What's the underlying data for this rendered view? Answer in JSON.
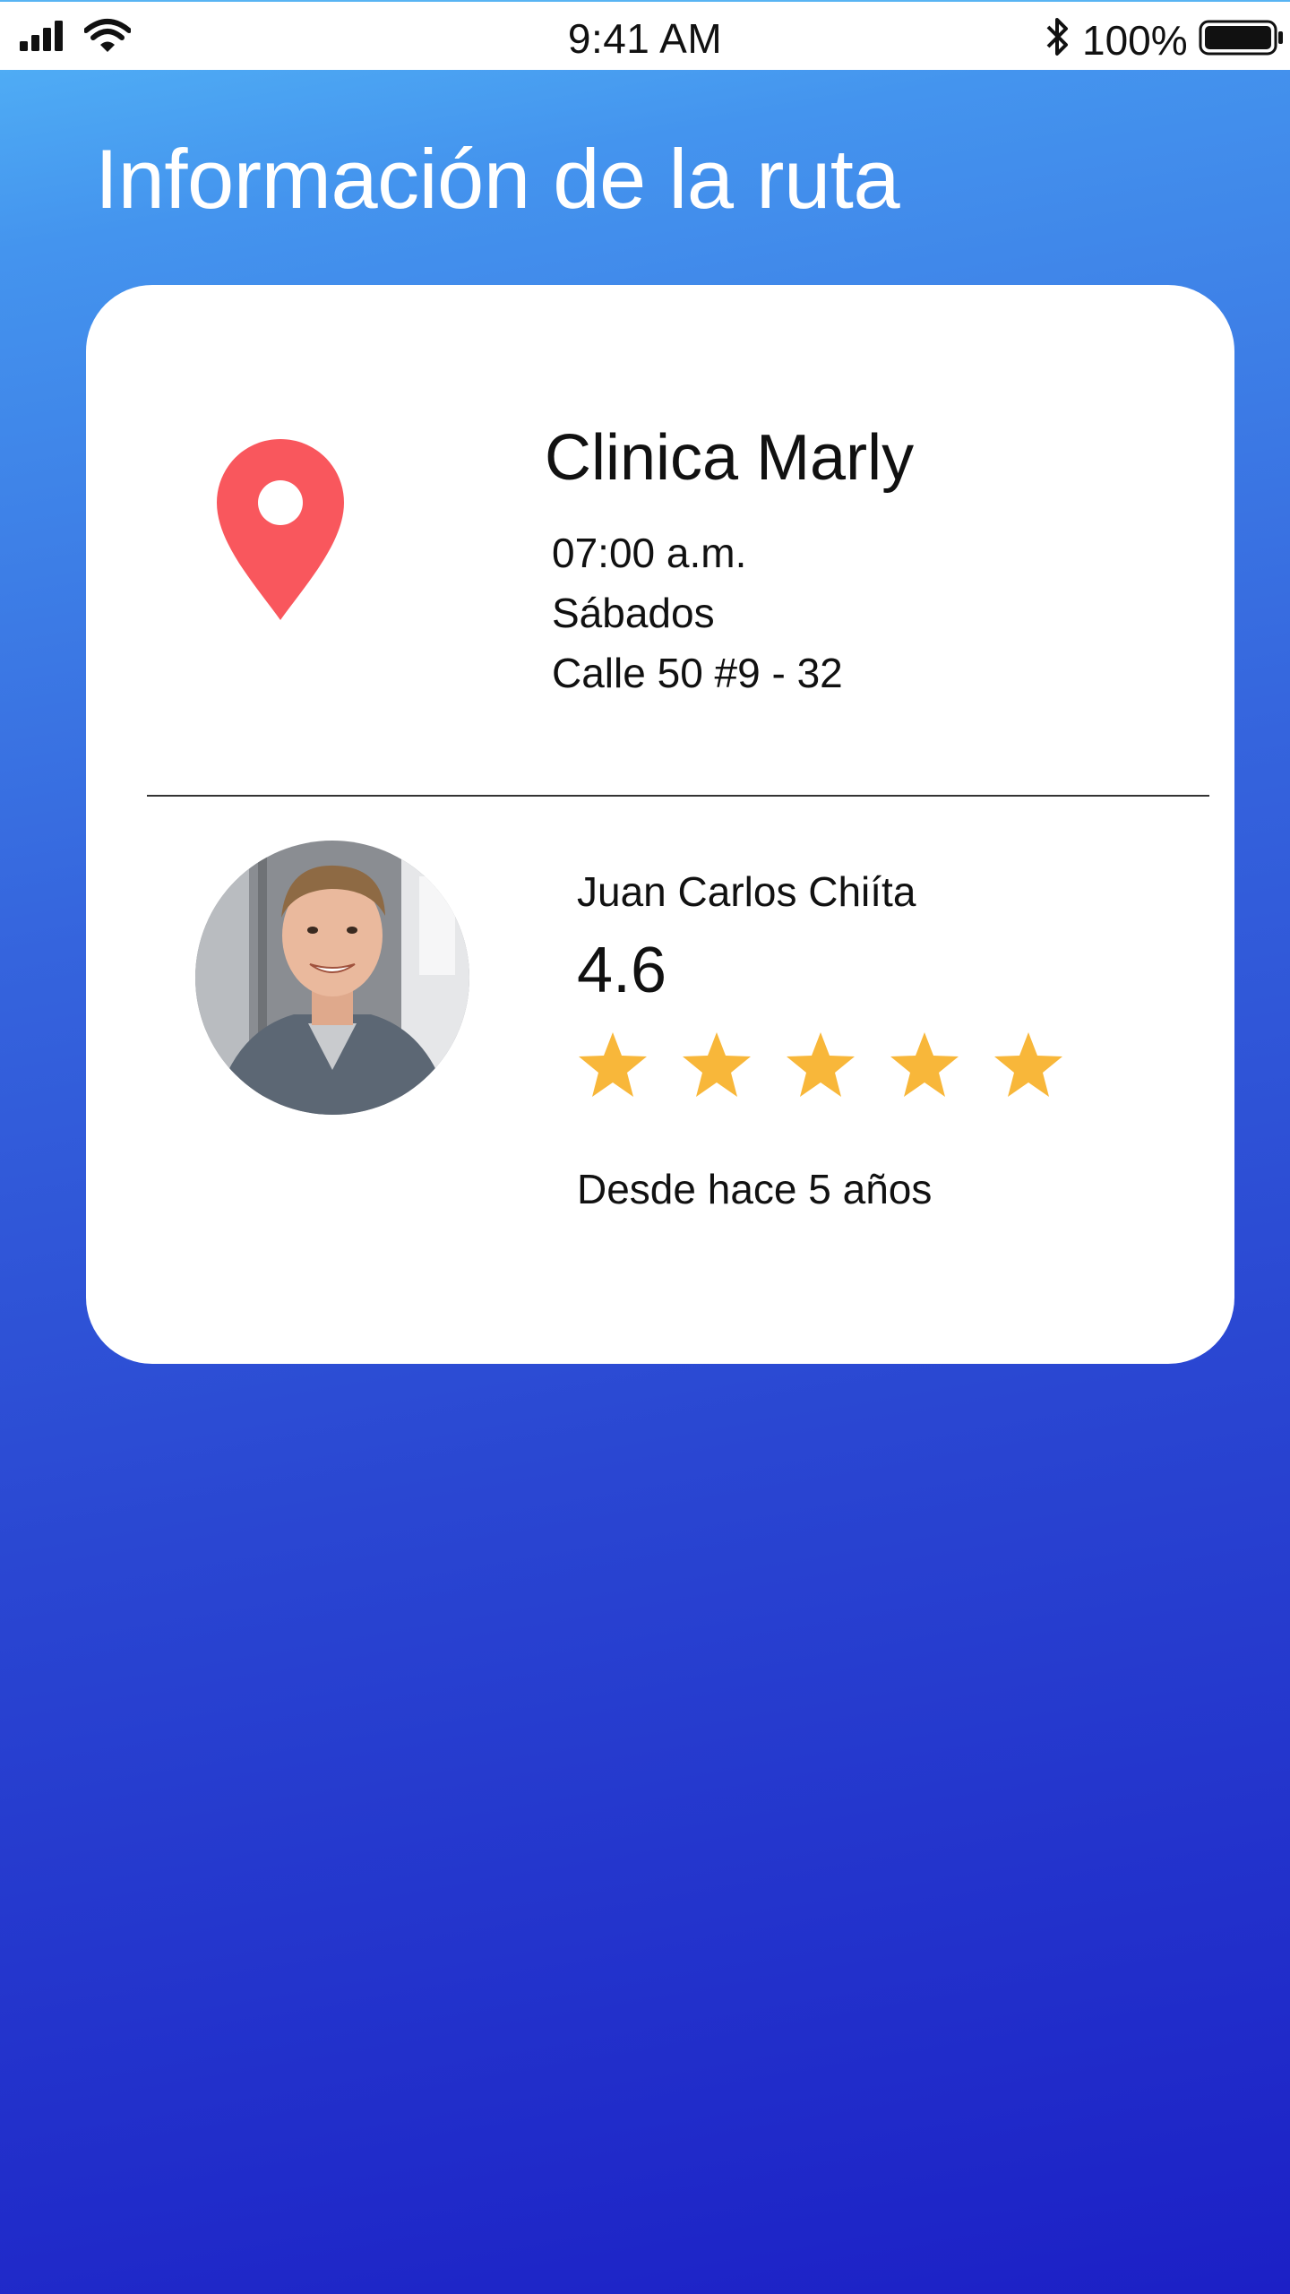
{
  "status_bar": {
    "time": "9:41 AM",
    "battery": "100%"
  },
  "page": {
    "title": "Información de la ruta"
  },
  "route": {
    "place": "Clinica Marly",
    "time": "07:00 a.m.",
    "day": "Sábados",
    "address": "Calle 50 #9 - 32"
  },
  "driver": {
    "name": "Juan Carlos Chiíta",
    "rating": "4.6",
    "stars": 5,
    "since": "Desde hace 5 años"
  },
  "colors": {
    "pin": "#f9575d",
    "star": "#f8b73a",
    "gradient_top": "#53b5f7",
    "gradient_bottom": "#1c20c6"
  }
}
